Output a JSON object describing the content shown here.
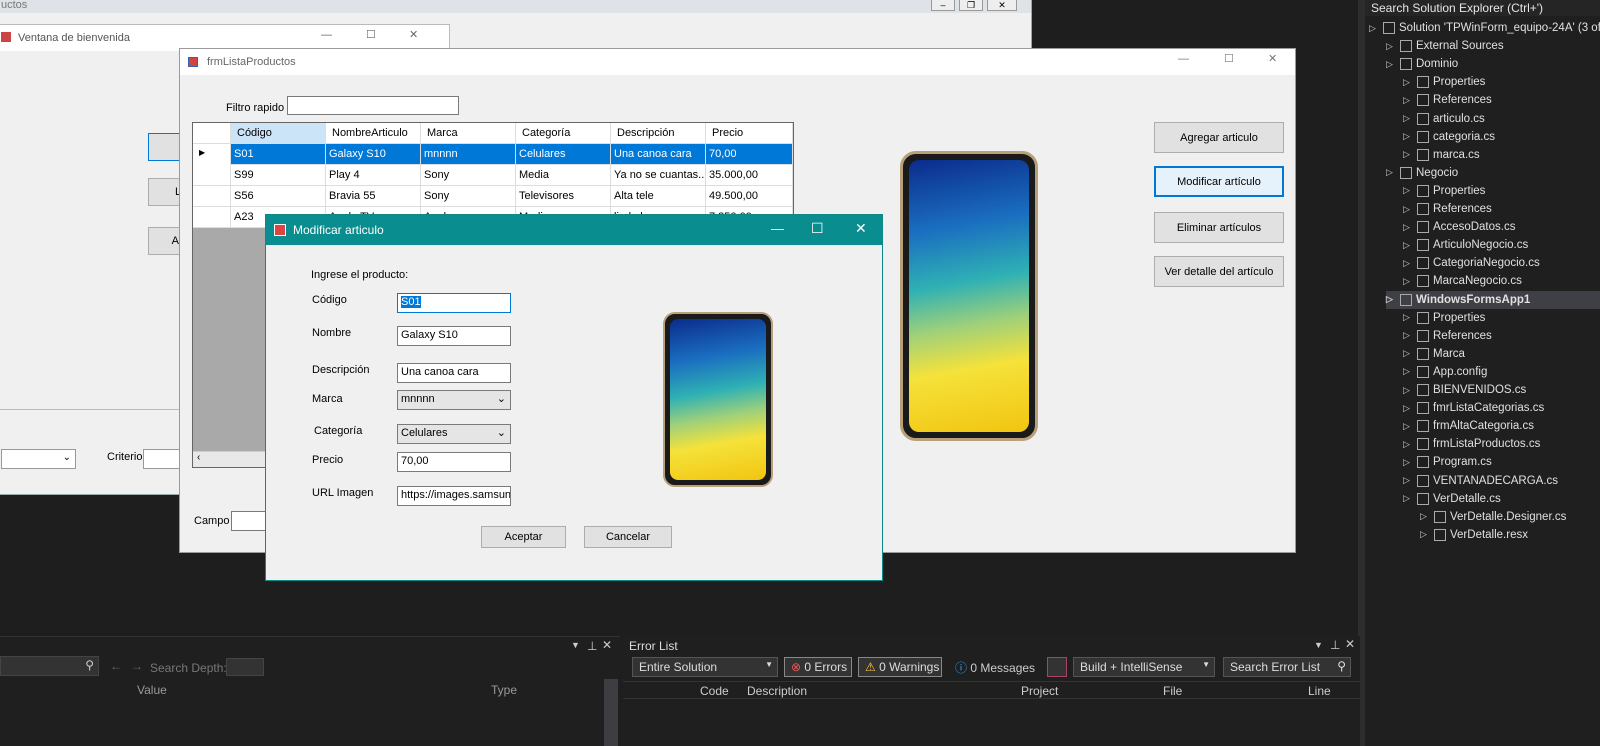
{
  "back_window": {
    "title": "uctos",
    "criterio_label": "Criterio",
    "campo_label": "Campo"
  },
  "welcome_window": {
    "title": "Ventana de bienvenida",
    "btn_l": "L",
    "btn_a": "Ac"
  },
  "list_window": {
    "title": "frmListaProductos",
    "filter_label": "Filtro rapido",
    "filter_value": "",
    "columns": [
      "Código",
      "NombreArticulo",
      "Marca",
      "Categoría",
      "Descripción",
      "Precio"
    ],
    "rows": [
      [
        "S01",
        "Galaxy S10",
        "mnnnn",
        "Celulares",
        "Una canoa cara",
        "70,00"
      ],
      [
        "S99",
        "Play 4",
        "Sony",
        "Media",
        "Ya no se cuantas...",
        "35.000,00"
      ],
      [
        "S56",
        "Bravia 55",
        "Sony",
        "Televisores",
        "Alta tele",
        "49.500,00"
      ],
      [
        "A23",
        "Apple TV",
        "Apple",
        "Media",
        "lindo lero",
        "7.850,00"
      ]
    ],
    "buttons": {
      "add": "Agregar articulo",
      "modify": "Modificar artículo",
      "delete": "Eliminar artículos",
      "detail": "Ver detalle del artículo"
    },
    "campo_label": "Campo"
  },
  "dialog": {
    "title": "Modificar articulo",
    "prompt": "Ingrese el producto:",
    "fields": {
      "codigo_label": "Código",
      "codigo": "S01",
      "nombre_label": "Nombre",
      "nombre": "Galaxy S10",
      "descripcion_label": "Descripción",
      "descripcion": "Una canoa cara",
      "marca_label": "Marca",
      "marca": "mnnnn",
      "categoria_label": "Categoría",
      "categoria": "Celulares",
      "precio_label": "Precio",
      "precio": "70,00",
      "url_label": "URL Imagen",
      "url": "https://images.samsung"
    },
    "accept": "Aceptar",
    "cancel": "Cancelar"
  },
  "solution_explorer": {
    "search": "Search Solution Explorer (Ctrl+')",
    "items": [
      {
        "label": "Solution 'TPWinForm_equipo-24A' (3 of",
        "level": 0,
        "bold": false
      },
      {
        "label": "External Sources",
        "level": 1,
        "bold": false
      },
      {
        "label": "Dominio",
        "level": 1,
        "bold": false
      },
      {
        "label": "Properties",
        "level": 2,
        "bold": false
      },
      {
        "label": "References",
        "level": 2,
        "bold": false
      },
      {
        "label": "articulo.cs",
        "level": 2,
        "bold": false
      },
      {
        "label": "categoria.cs",
        "level": 2,
        "bold": false
      },
      {
        "label": "marca.cs",
        "level": 2,
        "bold": false
      },
      {
        "label": "Negocio",
        "level": 1,
        "bold": false
      },
      {
        "label": "Properties",
        "level": 2,
        "bold": false
      },
      {
        "label": "References",
        "level": 2,
        "bold": false
      },
      {
        "label": "AccesoDatos.cs",
        "level": 2,
        "bold": false
      },
      {
        "label": "ArticuloNegocio.cs",
        "level": 2,
        "bold": false
      },
      {
        "label": "CategoriaNegocio.cs",
        "level": 2,
        "bold": false
      },
      {
        "label": "MarcaNegocio.cs",
        "level": 2,
        "bold": false
      },
      {
        "label": "WindowsFormsApp1",
        "level": 1,
        "bold": true
      },
      {
        "label": "Properties",
        "level": 2,
        "bold": false
      },
      {
        "label": "References",
        "level": 2,
        "bold": false
      },
      {
        "label": "Marca",
        "level": 2,
        "bold": false
      },
      {
        "label": "App.config",
        "level": 2,
        "bold": false
      },
      {
        "label": "BIENVENIDOS.cs",
        "level": 2,
        "bold": false
      },
      {
        "label": "fmrListaCategorias.cs",
        "level": 2,
        "bold": false
      },
      {
        "label": "frmAltaCategoria.cs",
        "level": 2,
        "bold": false
      },
      {
        "label": "frmListaProductos.cs",
        "level": 2,
        "bold": false
      },
      {
        "label": "Program.cs",
        "level": 2,
        "bold": false
      },
      {
        "label": "VENTANADECARGA.cs",
        "level": 2,
        "bold": false
      },
      {
        "label": "VerDetalle.cs",
        "level": 2,
        "bold": false
      },
      {
        "label": "VerDetalle.Designer.cs",
        "level": 3,
        "bold": false
      },
      {
        "label": "VerDetalle.resx",
        "level": 3,
        "bold": false
      }
    ]
  },
  "locals_panel": {
    "search_depth": "Search Depth:",
    "col_value": "Value",
    "col_type": "Type"
  },
  "error_list": {
    "title": "Error List",
    "scope": "Entire Solution",
    "errors": "0 Errors",
    "warnings": "0 Warnings",
    "messages": "0 Messages",
    "build": "Build + IntelliSense",
    "search": "Search Error List",
    "columns": [
      "Code",
      "Description",
      "Project",
      "File",
      "Line"
    ]
  },
  "colors": {
    "dialog_title": "#0a8d8e",
    "selection": "#0078d7",
    "vs_bg": "#1e1e1e"
  }
}
